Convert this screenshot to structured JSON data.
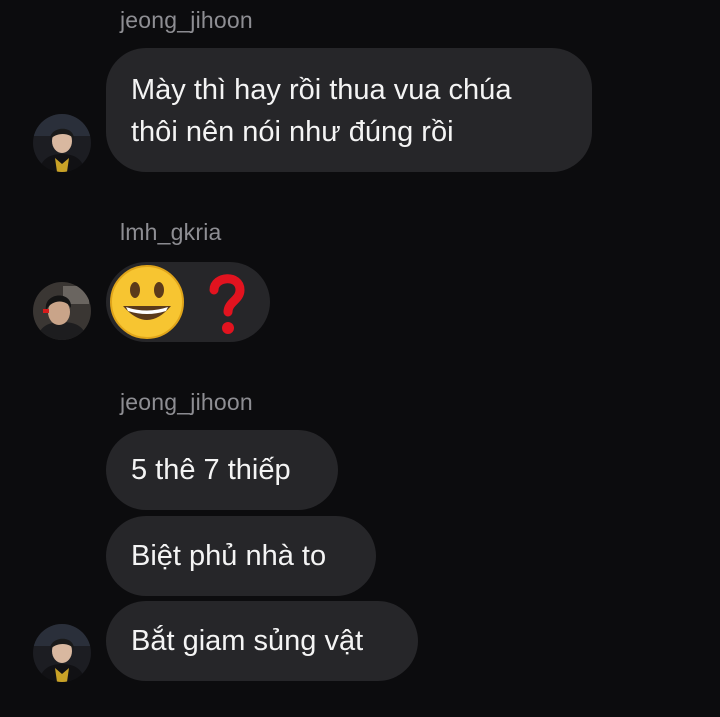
{
  "messages": [
    {
      "sender": "jeong_jihoon",
      "bubbles": [
        "Mày thì hay rồi thua vua chúa",
        "thôi nên nói như đúng rồi"
      ]
    },
    {
      "sender": "lmh_gkria",
      "emoji": [
        "grinning-face-emoji",
        "red-question-mark-emoji"
      ]
    },
    {
      "sender": "jeong_jihoon",
      "bubbles": [
        "5 thê 7 thiếp",
        "Biệt phủ nhà to",
        "Bắt giam sủng vật"
      ]
    }
  ],
  "colors": {
    "background": "#0c0c0e",
    "bubble": "#262629",
    "sender_name": "#8e8e93",
    "text": "#f4f4f4",
    "question_mark": "#e2131f"
  }
}
